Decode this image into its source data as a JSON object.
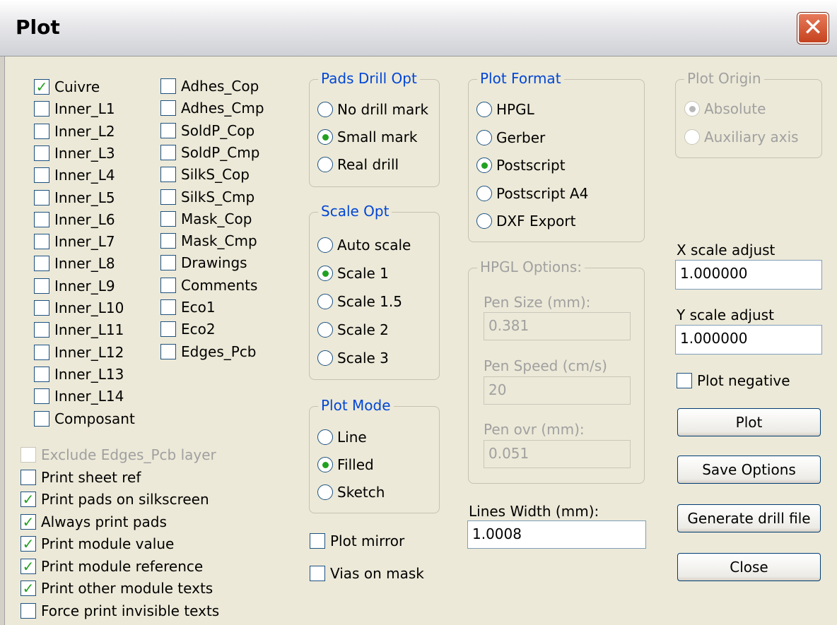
{
  "window": {
    "title": "Plot",
    "close_glyph": "✕"
  },
  "layers_col1": [
    {
      "label": "Cuivre",
      "checked": true
    },
    {
      "label": "Inner_L1",
      "checked": false
    },
    {
      "label": "Inner_L2",
      "checked": false
    },
    {
      "label": "Inner_L3",
      "checked": false
    },
    {
      "label": "Inner_L4",
      "checked": false
    },
    {
      "label": "Inner_L5",
      "checked": false
    },
    {
      "label": "Inner_L6",
      "checked": false
    },
    {
      "label": "Inner_L7",
      "checked": false
    },
    {
      "label": "Inner_L8",
      "checked": false
    },
    {
      "label": "Inner_L9",
      "checked": false
    },
    {
      "label": "Inner_L10",
      "checked": false
    },
    {
      "label": "Inner_L11",
      "checked": false
    },
    {
      "label": "Inner_L12",
      "checked": false
    },
    {
      "label": "Inner_L13",
      "checked": false
    },
    {
      "label": "Inner_L14",
      "checked": false
    },
    {
      "label": "Composant",
      "checked": false
    }
  ],
  "layers_col2": [
    {
      "label": "Adhes_Cop",
      "checked": false
    },
    {
      "label": "Adhes_Cmp",
      "checked": false
    },
    {
      "label": "SoldP_Cop",
      "checked": false
    },
    {
      "label": "SoldP_Cmp",
      "checked": false
    },
    {
      "label": "SilkS_Cop",
      "checked": false
    },
    {
      "label": "SilkS_Cmp",
      "checked": false
    },
    {
      "label": "Mask_Cop",
      "checked": false
    },
    {
      "label": "Mask_Cmp",
      "checked": false
    },
    {
      "label": "Drawings",
      "checked": false
    },
    {
      "label": "Comments",
      "checked": false
    },
    {
      "label": "Eco1",
      "checked": false
    },
    {
      "label": "Eco2",
      "checked": false
    },
    {
      "label": "Edges_Pcb",
      "checked": false
    }
  ],
  "print_options": [
    {
      "label": "Exclude Edges_Pcb layer",
      "checked": false,
      "disabled": true
    },
    {
      "label": "Print sheet ref",
      "checked": false
    },
    {
      "label": "Print pads on silkscreen",
      "checked": true
    },
    {
      "label": "Always print pads",
      "checked": true
    },
    {
      "label": "Print module value",
      "checked": true
    },
    {
      "label": "Print module reference",
      "checked": true
    },
    {
      "label": "Print other module texts",
      "checked": true
    },
    {
      "label": "Force print invisible texts",
      "checked": false
    }
  ],
  "pads_drill": {
    "title": "Pads Drill Opt",
    "options": [
      {
        "label": "No drill mark",
        "selected": false
      },
      {
        "label": "Small mark",
        "selected": true
      },
      {
        "label": "Real drill",
        "selected": false
      }
    ]
  },
  "scale_opt": {
    "title": "Scale Opt",
    "options": [
      {
        "label": "Auto scale",
        "selected": false
      },
      {
        "label": "Scale 1",
        "selected": true
      },
      {
        "label": "Scale 1.5",
        "selected": false
      },
      {
        "label": "Scale 2",
        "selected": false
      },
      {
        "label": "Scale 3",
        "selected": false
      }
    ]
  },
  "plot_mode": {
    "title": "Plot Mode",
    "options": [
      {
        "label": "Line",
        "selected": false
      },
      {
        "label": "Filled",
        "selected": true
      },
      {
        "label": "Sketch",
        "selected": false
      }
    ]
  },
  "plot_mirror": {
    "label": "Plot mirror",
    "checked": false
  },
  "vias_on_mask": {
    "label": "Vias on mask",
    "checked": false
  },
  "plot_format": {
    "title": "Plot Format",
    "options": [
      {
        "label": "HPGL",
        "selected": false
      },
      {
        "label": "Gerber",
        "selected": false
      },
      {
        "label": "Postscript",
        "selected": true
      },
      {
        "label": "Postscript A4",
        "selected": false
      },
      {
        "label": "DXF Export",
        "selected": false
      }
    ]
  },
  "hpgl_options": {
    "title": "HPGL Options:",
    "pen_size_label": "Pen Size (mm):",
    "pen_size_value": "0.381",
    "pen_speed_label": "Pen Speed (cm/s)",
    "pen_speed_value": "20",
    "pen_ovr_label": "Pen ovr (mm):",
    "pen_ovr_value": "0.051"
  },
  "lines_width": {
    "label": "Lines Width (mm):",
    "value": "1.0008"
  },
  "plot_origin": {
    "title": "Plot Origin",
    "options": [
      {
        "label": "Absolute",
        "selected": true
      },
      {
        "label": "Auxiliary axis",
        "selected": false
      }
    ]
  },
  "x_scale": {
    "label": "X scale adjust",
    "value": "1.000000"
  },
  "y_scale": {
    "label": "Y scale adjust",
    "value": "1.000000"
  },
  "plot_negative": {
    "label": "Plot negative",
    "checked": false
  },
  "buttons": {
    "plot": "Plot",
    "save_options": "Save Options",
    "generate_drill": "Generate drill file",
    "close": "Close"
  }
}
